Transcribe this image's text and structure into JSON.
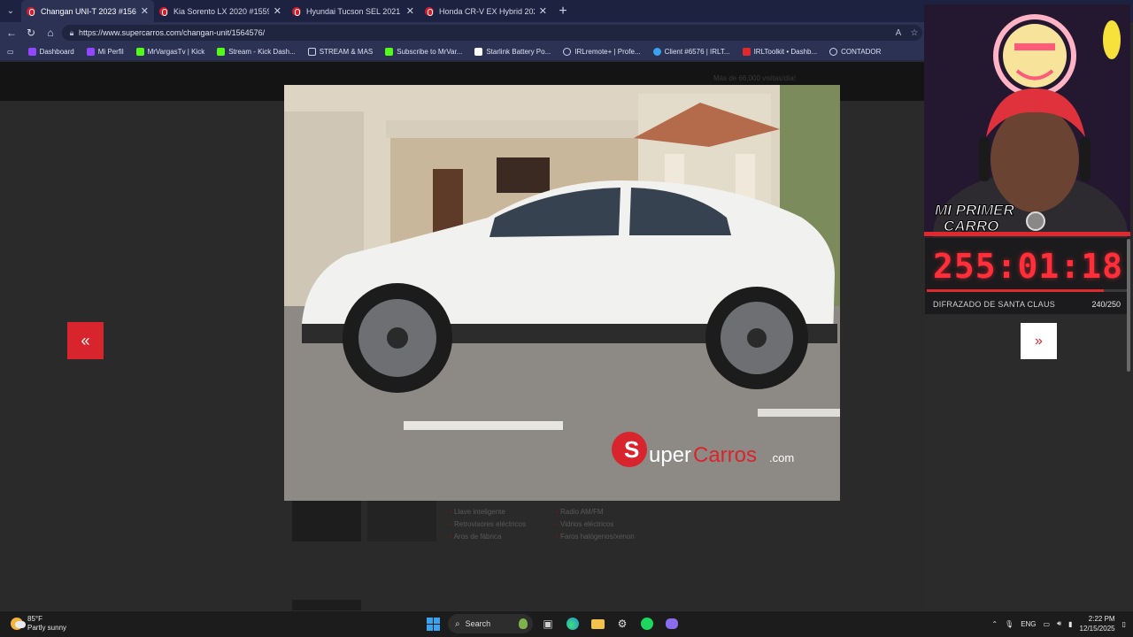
{
  "browser": {
    "tabs": [
      {
        "label": "Changan UNI-T 2023 #1564576 - S",
        "active": true
      },
      {
        "label": "Kia Sorento LX 2020 #1559749 - S",
        "active": false
      },
      {
        "label": "Hyundai Tucson SEL 2021 #14910",
        "active": false
      },
      {
        "label": "Honda CR-V EX Hybrid 2022 #15",
        "active": false
      }
    ],
    "url": "https://www.supercarros.com/changan-unit/1564576/",
    "bookmarks": [
      {
        "label": "Dashboard",
        "color": "#9146ff"
      },
      {
        "label": "Mi Perfil",
        "color": "#9146ff"
      },
      {
        "label": "MrVargasTv | Kick",
        "color": "#53fc18"
      },
      {
        "label": "Stream - Kick Dash...",
        "color": "#53fc18"
      },
      {
        "label": "STREAM & MAS",
        "color": "#cfd3e6"
      },
      {
        "label": "Subscribe to MrVar...",
        "color": "#53fc18"
      },
      {
        "label": "Starlink Battery Po...",
        "color": "#ffffff"
      },
      {
        "label": "IRLremote+ | Profe...",
        "color": "#cfd3e6"
      },
      {
        "label": "Client #6576 | IRLT...",
        "color": "#3aa3f0"
      },
      {
        "label": "IRLToolkit • Dashb...",
        "color": "#e0282f"
      },
      {
        "label": "CONTADOR",
        "color": "#cfd3e6"
      }
    ]
  },
  "site": {
    "visits_text": "Más de 66,000 visitas/día!",
    "features": [
      "Llave inteligente",
      "Radio AM/FM",
      "Retrovisores eléctricos",
      "Vidrios eléctricos",
      "Aros de fábrica",
      "Faros halógenos/xenon"
    ],
    "watermark_brand": "SuperCarros.com",
    "prev_label": "«",
    "next_label": "»",
    "thumbnail_count": 11,
    "active_thumbnail": 2
  },
  "overlay": {
    "stream_title": "MI PRIMER CARRO",
    "timer": "255:01:18",
    "goal_label": "DIFRAZADO DE SANTA CLAUS",
    "goal_count": "240/250",
    "goal_progress": 0.96
  },
  "taskbar": {
    "temperature": "85°F",
    "weather": "Partly sunny",
    "search_label": "Search",
    "language": "ENG",
    "time": "2:22 PM",
    "date": "12/15/2025"
  }
}
